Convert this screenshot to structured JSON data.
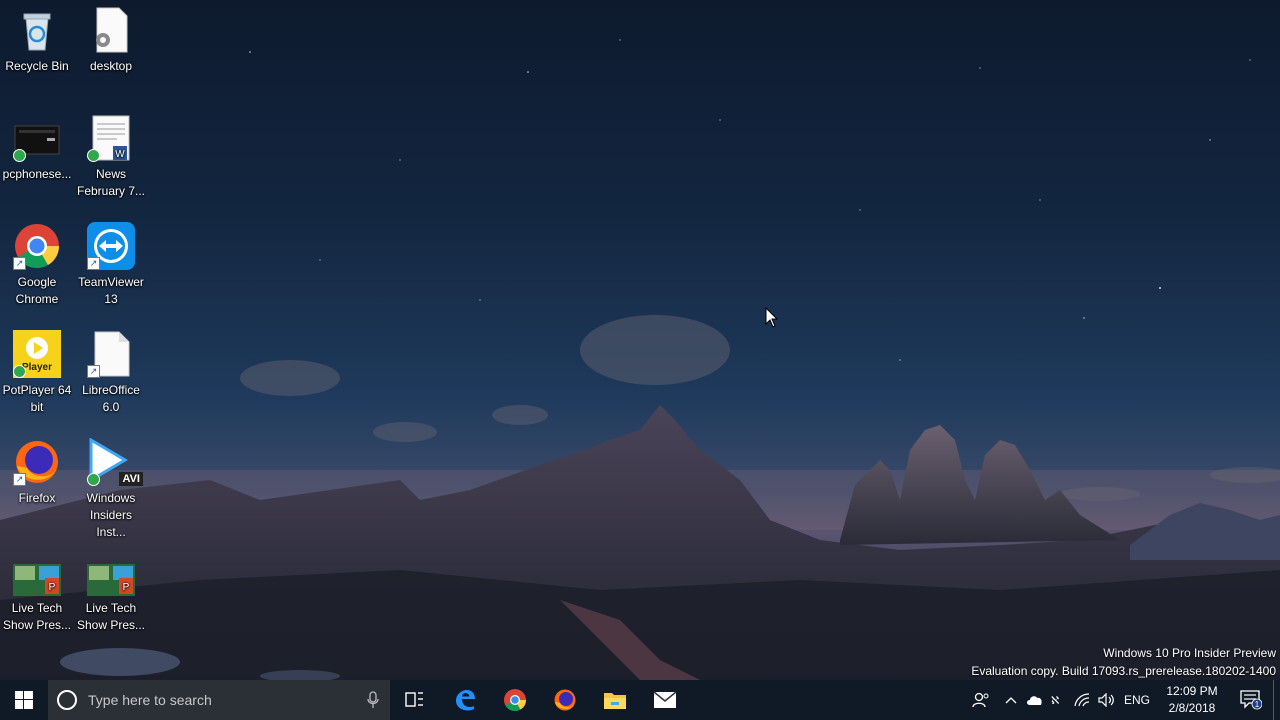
{
  "desktop": {
    "icons": [
      {
        "label": "Recycle Bin"
      },
      {
        "label": "desktop"
      },
      {
        "label": "pcphonese..."
      },
      {
        "label": "News February 7..."
      },
      {
        "label": "Google Chrome"
      },
      {
        "label": "TeamViewer 13"
      },
      {
        "label": "PotPlayer 64 bit"
      },
      {
        "label": "LibreOffice 6.0"
      },
      {
        "label": "Firefox"
      },
      {
        "label": "Windows Insiders Inst..."
      },
      {
        "label": "Live Tech Show Pres..."
      },
      {
        "label": "Live Tech Show Pres..."
      }
    ],
    "potplayer_badge": "Player",
    "avi_badge": "AVI"
  },
  "watermark": {
    "line1": "Windows 10 Pro Insider Preview",
    "line2": "Evaluation copy. Build 17093.rs_prerelease.180202-1400"
  },
  "taskbar": {
    "search_placeholder": "Type here to search",
    "pinned": [
      "task-view",
      "edge",
      "chrome",
      "firefox",
      "file-explorer",
      "mail"
    ],
    "language": "ENG",
    "time": "12:09 PM",
    "date": "2/8/2018",
    "notification_count": "1"
  },
  "colors": {
    "taskbar": "#101a26",
    "search": "#2b2f36",
    "accent": "#1e90ff"
  }
}
